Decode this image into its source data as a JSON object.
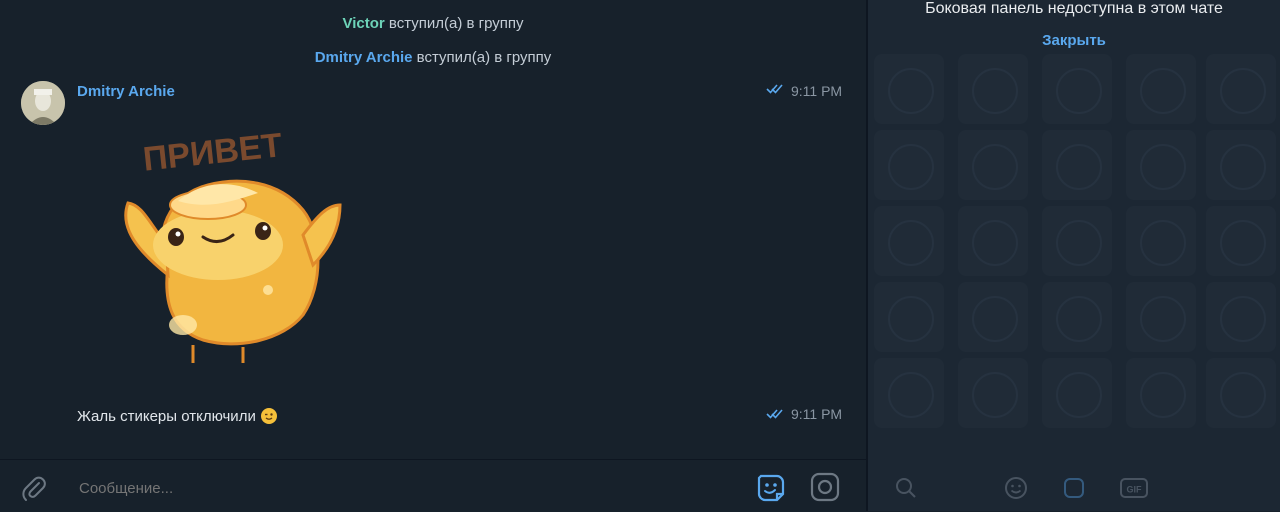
{
  "chat": {
    "service_messages": [
      {
        "name": "Victor",
        "text": "вступил(а) в группу",
        "name_color": "#6dd3b8"
      },
      {
        "name": "Dmitry Archie",
        "text": "вступил(а) в группу",
        "name_color": "#5aa8ee"
      }
    ],
    "messages": [
      {
        "sender": "Dmitry Archie",
        "time": "9:11 PM",
        "sticker_text": "ПРИВЕТ"
      },
      {
        "text": "Жаль стикеры отключили",
        "time": "9:11 PM"
      }
    ]
  },
  "composer": {
    "placeholder": "Сообщение..."
  },
  "sidebar": {
    "notice": "Боковая панель недоступна в этом чате",
    "close_label": "Закрыть"
  },
  "colors": {
    "background": "#17212b",
    "sidebar_bg": "#1c2733",
    "accent": "#5aa8ee",
    "read_check": "#5aa8ee"
  },
  "icons": [
    "attach-icon",
    "sticker-icon",
    "camera-icon",
    "double-check-icon",
    "search-icon",
    "smile-icon",
    "gif-icon"
  ]
}
